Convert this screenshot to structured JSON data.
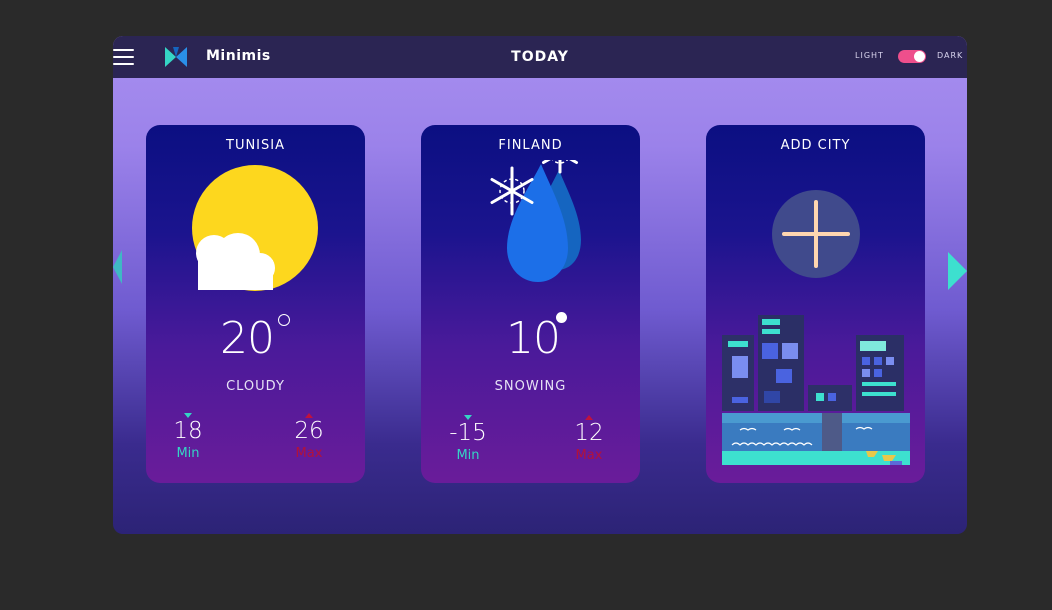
{
  "app": {
    "name": "Minimis",
    "page_title": "TODAY"
  },
  "theme_toggle": {
    "light_label": "LIGHT",
    "dark_label": "DARK",
    "state": "dark"
  },
  "cards": [
    {
      "city": "TUNISIA",
      "temp": "20",
      "condition": "CLOUDY",
      "min": "18",
      "max": "26",
      "min_label": "Min",
      "max_label": "Max",
      "icon": "sun-cloud-icon"
    },
    {
      "city": "FINLAND",
      "temp": "10",
      "condition": "SNOWING",
      "min": "-15",
      "max": "12",
      "min_label": "Min",
      "max_label": "Max",
      "icon": "snow-drops-icon"
    },
    {
      "city": "ADD CITY",
      "icon": "plus-icon",
      "illustration": "city-skyline-illustration"
    }
  ],
  "colors": {
    "accent_teal": "#3de0cf",
    "toggle_pink": "#ee4f8c",
    "sun_yellow": "#fdd71e",
    "min_color": "#35d4c5",
    "max_color": "#b1123c"
  }
}
